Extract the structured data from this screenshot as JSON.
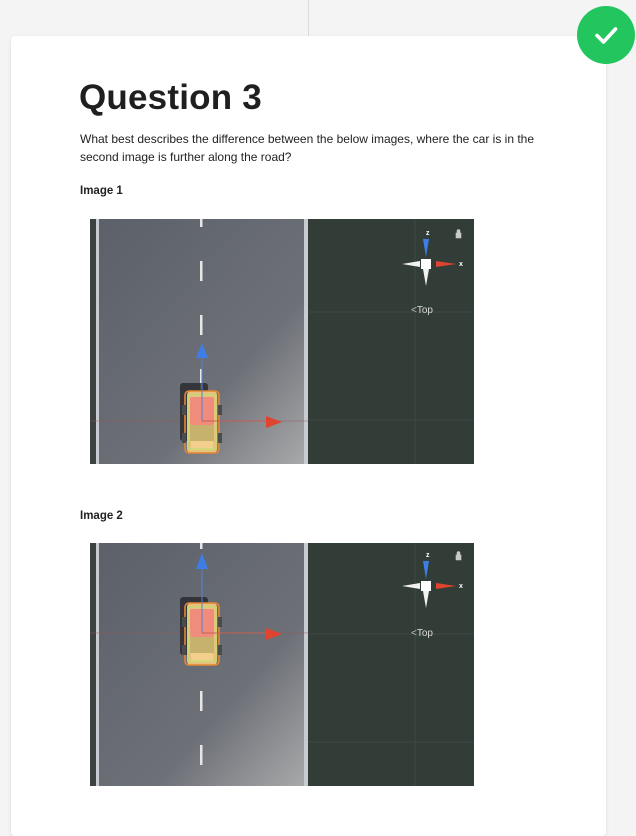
{
  "question": {
    "title": "Question 3",
    "prompt": "What best describes the difference between the below images, where the car is in the second image is further along the road?"
  },
  "images": [
    {
      "label": "Image 1",
      "gizmo_view_label": "Top",
      "axis_x": "x",
      "axis_z": "z"
    },
    {
      "label": "Image 2",
      "gizmo_view_label": "Top",
      "axis_x": "x",
      "axis_z": "z"
    }
  ],
  "status": {
    "icon": "checkmark-icon",
    "color": "#22c55e"
  }
}
